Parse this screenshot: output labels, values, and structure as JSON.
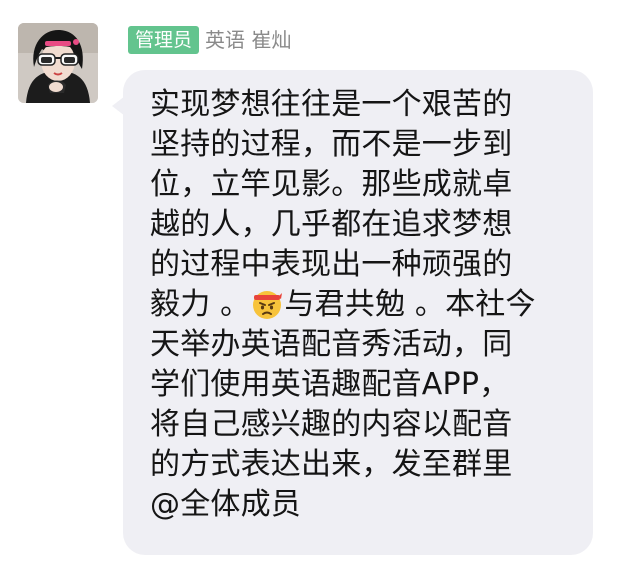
{
  "message": {
    "sender_badge": "管理员",
    "sender_name": "英语 崔灿",
    "lines": [
      "实现梦想往往是一个艰苦的",
      "坚持的过程，而不是一步到",
      "位，立竿见影。那些成就卓",
      "越的人，几乎都在追求梦想",
      "的过程中表现出一种顽强的"
    ],
    "line6_before": "毅力 。",
    "line6_emoji": "headband-persevere-emoji",
    "line6_after": "与君共勉 。本社今",
    "lines_after": [
      "天举办英语配音秀活动，同",
      "学们使用英语趣配音APP，",
      "将自己感兴趣的内容以配音",
      "的方式表达出来，发至群里",
      "@全体成员"
    ]
  },
  "colors": {
    "badge_bg": "#63c48e",
    "bubble_bg": "#efeff4",
    "text": "#151515",
    "sender_text": "#8a8a8a"
  }
}
